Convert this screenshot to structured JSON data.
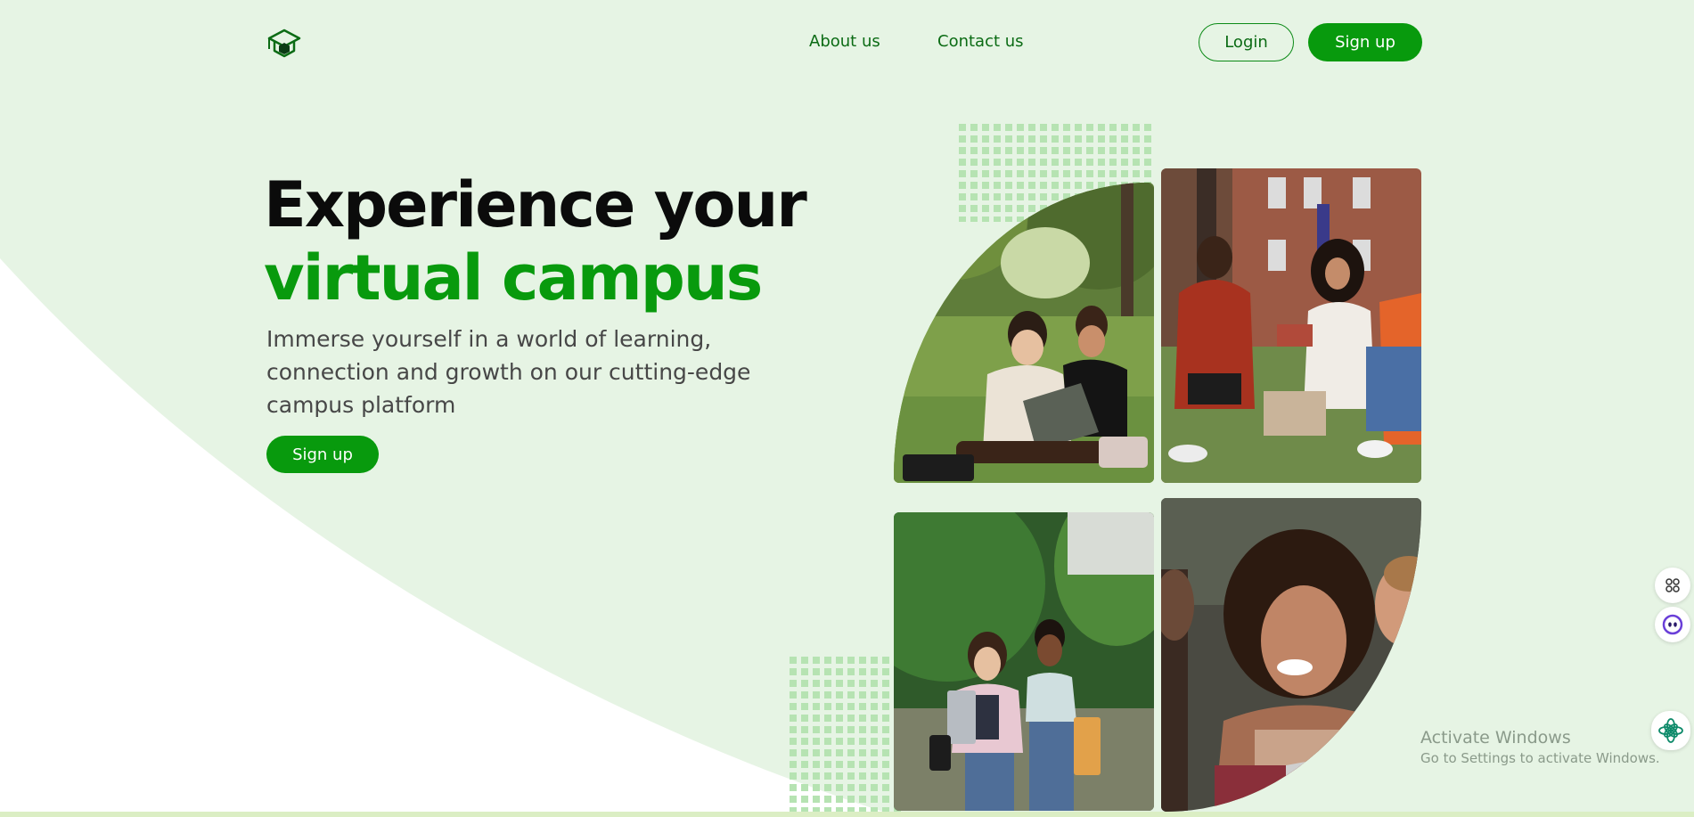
{
  "colors": {
    "background_mint": "#e6f4e4",
    "brand_green": "#089a0d",
    "dark_green_text": "#0b6b14",
    "heading_black": "#0b0b0b",
    "subtext_gray": "#474747",
    "dot_pattern": "#b6e3b2"
  },
  "header": {
    "logo_icon": "graduation-cap-icon",
    "nav": {
      "about": "About us",
      "contact": "Contact us"
    },
    "login_label": "Login",
    "signup_label": "Sign up"
  },
  "hero": {
    "title_line1": "Experience your",
    "title_line2": "virtual campus",
    "subtitle": "Immerse yourself in a world of learning, connection and growth on our cutting-edge campus platform",
    "cta_label": "Sign up"
  },
  "gallery": {
    "photos": [
      {
        "subject": "two students with a laptop sitting on grass in a park"
      },
      {
        "subject": "group of students studying on lawn in front of brick building"
      },
      {
        "subject": "two female students walking on a tree-lined path"
      },
      {
        "subject": "smiling student with curly hair looking at a laptop"
      }
    ]
  },
  "side_widgets": [
    {
      "icon": "apps-grid-icon"
    },
    {
      "icon": "assistant-face-icon"
    },
    {
      "icon": "ai-flower-icon"
    }
  ],
  "watermark": {
    "title": "Activate Windows",
    "subtitle": "Go to Settings to activate Windows."
  }
}
